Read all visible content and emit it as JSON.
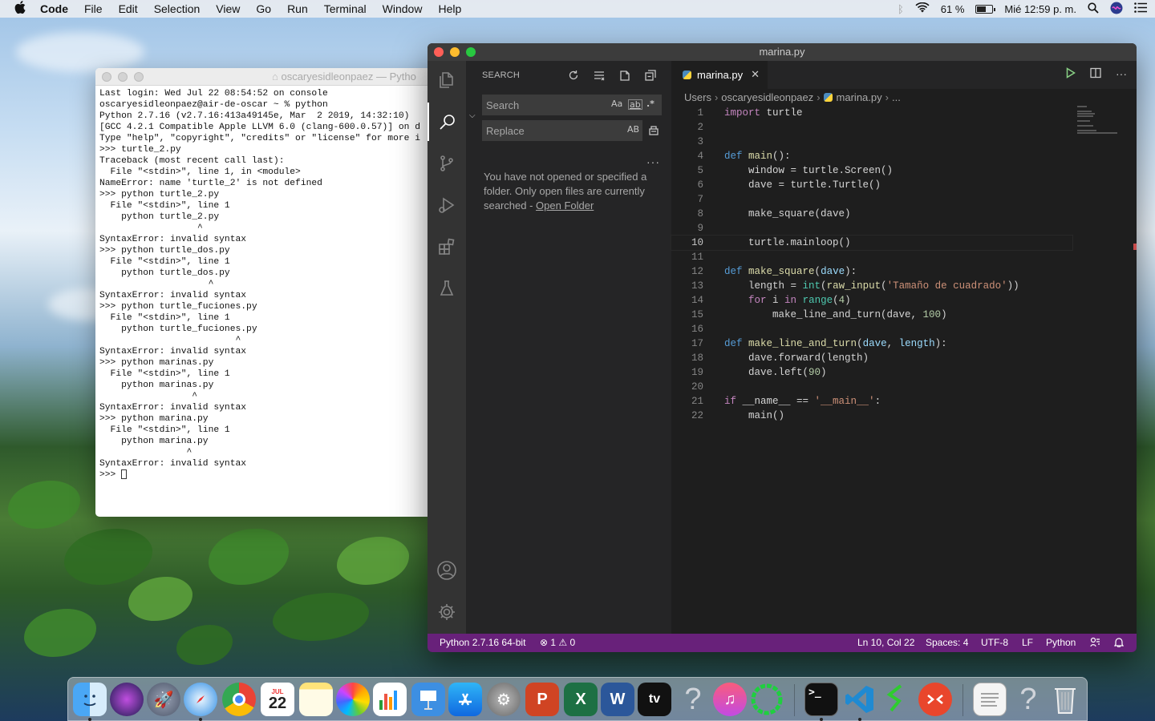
{
  "menubar": {
    "app_name": "Code",
    "items": [
      "File",
      "Edit",
      "Selection",
      "View",
      "Go",
      "Run",
      "Terminal",
      "Window",
      "Help"
    ],
    "battery": "61 %",
    "battery_level": 0.61,
    "clock": "Mié 12:59 p. m."
  },
  "terminal": {
    "title": "oscaryesidleonpaez — Pytho",
    "lines": [
      "Last login: Wed Jul 22 08:54:52 on console",
      "oscaryesidleonpaez@air-de-oscar ~ % python",
      "Python 2.7.16 (v2.7.16:413a49145e, Mar  2 2019, 14:32:10)",
      "[GCC 4.2.1 Compatible Apple LLVM 6.0 (clang-600.0.57)] on d",
      "Type \"help\", \"copyright\", \"credits\" or \"license\" for more i",
      ">>> turtle_2.py",
      "Traceback (most recent call last):",
      "  File \"<stdin>\", line 1, in <module>",
      "NameError: name 'turtle_2' is not defined",
      ">>> python turtle_2.py",
      "  File \"<stdin>\", line 1",
      "    python turtle_2.py",
      "                  ^",
      "SyntaxError: invalid syntax",
      ">>> python turtle_dos.py",
      "  File \"<stdin>\", line 1",
      "    python turtle_dos.py",
      "                    ^",
      "SyntaxError: invalid syntax",
      ">>> python turtle_fuciones.py",
      "  File \"<stdin>\", line 1",
      "    python turtle_fuciones.py",
      "                         ^",
      "SyntaxError: invalid syntax",
      ">>> python marinas.py",
      "  File \"<stdin>\", line 1",
      "    python marinas.py",
      "                 ^",
      "SyntaxError: invalid syntax",
      ">>> python marina.py",
      "  File \"<stdin>\", line 1",
      "    python marina.py",
      "                ^",
      "SyntaxError: invalid syntax"
    ],
    "prompt": ">>> "
  },
  "vscode": {
    "window_title": "marina.py",
    "sidebar": {
      "title": "SEARCH",
      "search_placeholder": "Search",
      "replace_placeholder": "Replace",
      "match_case": "Aa",
      "whole_word": "ab",
      "regex": ".*",
      "preserve_case": "AB",
      "message": "You have not opened or specified a folder. Only open files are currently searched - ",
      "open_folder": "Open Folder",
      "more": "···"
    },
    "tab": {
      "label": "marina.py"
    },
    "breadcrumb": [
      "Users",
      "oscaryesidleonpaez",
      "marina.py",
      "..."
    ],
    "code_lines": [
      "1",
      "2",
      "3",
      "4",
      "5",
      "6",
      "7",
      "8",
      "9",
      "10",
      "11",
      "12",
      "13",
      "14",
      "15",
      "16",
      "17",
      "18",
      "19",
      "20",
      "21",
      "22"
    ],
    "code": {
      "l1_kw": "import",
      "l1_rest": " turtle",
      "l4_kw": "def",
      "l4_fn": "main",
      "l4_rest": "():",
      "l5": "    window = turtle.Screen()",
      "l6": "    dave = turtle.Turtle()",
      "l8": "    make_square(dave)",
      "l10": "    turtle.mainloop()",
      "l12_kw": "def",
      "l12_fn": "make_square",
      "l12_p": "dave",
      "l12_end": "):",
      "l13_a": "    length = ",
      "l13_int": "int",
      "l13_b": "(",
      "l13_ri": "raw_input",
      "l13_c": "(",
      "l13_str": "'Tamaño de cuadrado'",
      "l13_d": "))",
      "l14_for": "    for",
      "l14_a": " i ",
      "l14_in": "in",
      "l14_sp": " ",
      "l14_range": "range",
      "l14_b": "(",
      "l14_n": "4",
      "l14_c": ")",
      "l15_a": "        make_line_and_turn(dave, ",
      "l15_n": "100",
      "l15_b": ")",
      "l17_kw": "def",
      "l17_fn": "make_line_and_turn",
      "l17_a": "(",
      "l17_p1": "dave",
      "l17_b": ", ",
      "l17_p2": "length",
      "l17_c": "):",
      "l18": "    dave.forward(length)",
      "l19_a": "    dave.left(",
      "l19_n": "90",
      "l19_b": ")",
      "l21_if": "if",
      "l21_a": " __name__ == ",
      "l21_str": "'__main__'",
      "l21_b": ":",
      "l22": "    main()"
    },
    "status": {
      "interpreter": "Python 2.7.16 64-bit",
      "problems": "⊗ 1 ⚠ 0",
      "position": "Ln 10, Col 22",
      "spaces": "Spaces: 4",
      "encoding": "UTF-8",
      "eol": "LF",
      "language": "Python"
    }
  },
  "dock": {
    "calendar_month": "JUL",
    "calendar_day": "22",
    "appletv": "tv"
  }
}
